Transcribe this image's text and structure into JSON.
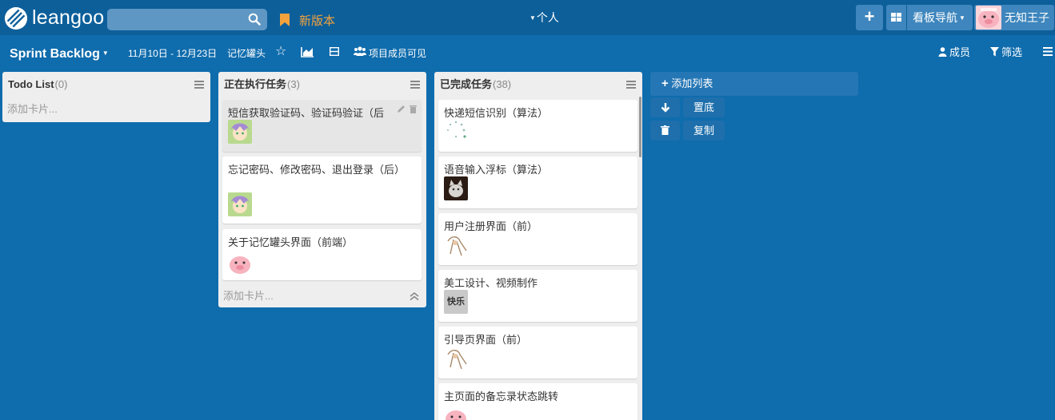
{
  "topbar": {
    "logo_text": "leangoo",
    "search_placeholder": "",
    "new_version": "新版本",
    "personal": "个人",
    "board_nav": "看板导航",
    "user_name": "无知王子"
  },
  "subbar": {
    "board_title": "Sprint Backlog",
    "date_range": "11月10日 - 12月23日",
    "project_name": "记忆罐头",
    "visibility": "项目成员可见",
    "members": "成员",
    "filter": "筛选"
  },
  "lists": [
    {
      "title": "Todo List",
      "count": "(0)",
      "add_card": "添加卡片...",
      "cards": []
    },
    {
      "title": "正在执行任务",
      "count": "(3)",
      "add_card": "添加卡片...",
      "cards": [
        {
          "title": "短信获取验证码、验证码验证（后",
          "avatar": "anime-avatar-icon"
        },
        {
          "title": "忘记密码、修改密码、退出登录（后）",
          "avatar": "anime-avatar-icon"
        },
        {
          "title": "关于记忆罐头界面（前端）",
          "avatar": "pig-avatar-icon"
        }
      ]
    },
    {
      "title": "已完成任务",
      "count": "(38)",
      "cards": [
        {
          "title": "快递短信识别（算法）",
          "avatar": "loading-icon"
        },
        {
          "title": "语音输入浮标（算法）",
          "avatar": "cat-avatar-icon"
        },
        {
          "title": "用户注册界面（前）",
          "avatar": "sketch-avatar-icon"
        },
        {
          "title": "美工设计、视频制作",
          "avatar_label": "快乐"
        },
        {
          "title": "引导页界面（前）",
          "avatar": "sketch-avatar-icon"
        },
        {
          "title": "主页面的备忘录状态跳转",
          "avatar": "pig-avatar-icon"
        }
      ]
    }
  ],
  "add_list": {
    "label": "添加列表",
    "to_bottom": "置底",
    "copy": "复制"
  },
  "colors": {
    "background": "#0f6cad",
    "topbar": "#0d5f9a",
    "accent_orange": "#f3a23c",
    "list_bg": "#eeeeee"
  }
}
